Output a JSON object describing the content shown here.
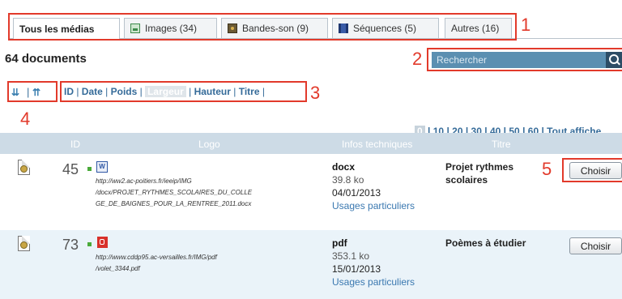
{
  "tabs": [
    {
      "label": "Tous les médias",
      "icon": "none",
      "active": true
    },
    {
      "label": "Images (34)",
      "icon": "image-icon"
    },
    {
      "label": "Bandes-son (9)",
      "icon": "audio-icon"
    },
    {
      "label": "Séquences (5)",
      "icon": "video-icon"
    },
    {
      "label": "Autres (16)",
      "icon": "none"
    }
  ],
  "callouts": [
    "1",
    "2",
    "3",
    "4",
    "5"
  ],
  "document_count": "64 documents",
  "search": {
    "placeholder": "Rechercher"
  },
  "sort": {
    "order_sep": "|",
    "fields": [
      "ID",
      "Date",
      "Poids",
      "Largeur",
      "Hauteur",
      "Titre"
    ],
    "current": "Largeur"
  },
  "pagination": {
    "current": "0",
    "links": [
      "10",
      "20",
      "30",
      "40",
      "50",
      "60"
    ],
    "all_label": "Tout affiche"
  },
  "table": {
    "headers": {
      "id": "ID",
      "logo": "Logo",
      "tech": "Infos techniques",
      "title": "Titre"
    },
    "rows": [
      {
        "id": "45",
        "type_icon": "word-icon",
        "url_lines": [
          "http://ww2.ac-poitiers.fr/ieeip/IMG",
          "/docx/PROJET_RYTHMES_SCOLAIRES_DU_COLLE",
          "GE_DE_BAIGNES_POUR_LA_RENTREE_2011.docx"
        ],
        "ext": "docx",
        "size": "39.8 ko",
        "date": "04/01/2013",
        "usage": "Usages particuliers",
        "title_lines": [
          "Projet rythmes",
          "scolaires"
        ],
        "choose": "Choisir"
      },
      {
        "id": "73",
        "type_icon": "pdf-icon",
        "url_lines": [
          "http://www.cddp95.ac-versailles.fr/IMG/pdf",
          "/volet_3344.pdf"
        ],
        "ext": "pdf",
        "size": "353.1 ko",
        "date": "15/01/2013",
        "usage": "Usages particuliers",
        "title_lines": [
          "Poèmes à étudier"
        ],
        "choose": "Choisir"
      }
    ]
  },
  "colors": {
    "callout": "#e23a2b",
    "link": "#356b99",
    "header": "#cddbe6",
    "search": "#5b8fb1"
  }
}
